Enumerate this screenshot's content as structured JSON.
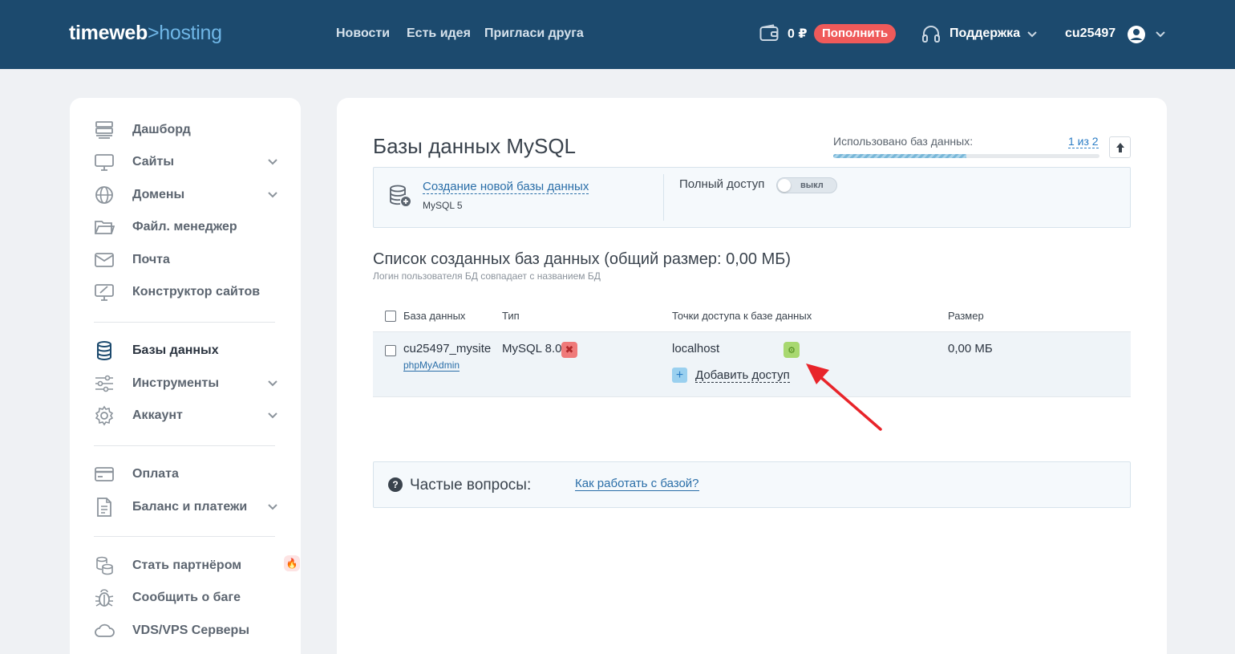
{
  "header": {
    "logo_main": "timeweb",
    "logo_sep": ">",
    "logo_sub": "hosting",
    "nav": [
      "Новости",
      "Есть идея",
      "Пригласи друга"
    ],
    "balance": "0 ₽",
    "topup_label": "Пополнить",
    "support_label": "Поддержка",
    "username": "cu25497"
  },
  "sidebar": {
    "items": [
      {
        "label": "Дашборд",
        "icon": "dashboard-icon"
      },
      {
        "label": "Сайты",
        "icon": "monitor-icon"
      },
      {
        "label": "Домены",
        "icon": "globe-icon"
      },
      {
        "label": "Файл. менеджер",
        "icon": "folder-icon"
      },
      {
        "label": "Почта",
        "icon": "mail-icon"
      },
      {
        "label": "Конструктор сайтов",
        "icon": "builder-icon"
      },
      {
        "label": "Базы данных",
        "icon": "database-icon"
      },
      {
        "label": "Инструменты",
        "icon": "sliders-icon"
      },
      {
        "label": "Аккаунт",
        "icon": "gear-icon"
      },
      {
        "label": "Оплата",
        "icon": "card-icon"
      },
      {
        "label": "Баланс и платежи",
        "icon": "document-icon"
      },
      {
        "label": "Стать партнёром",
        "icon": "coins-icon"
      },
      {
        "label": "Сообщить о баге",
        "icon": "bug-icon"
      },
      {
        "label": "VDS/VPS Серверы",
        "icon": "cloud-icon"
      }
    ]
  },
  "main": {
    "title": "Базы данных MySQL",
    "usage_label": "Использовано баз данных:",
    "usage_value": "1 из 2",
    "usage_fraction": 0.5,
    "create_link": "Создание новой базы данных",
    "create_sub": "MySQL 5",
    "full_access_label": "Полный доступ",
    "toggle_label": "выкл",
    "list_title": "Список созданных баз данных (общий размер: 0,00 МБ)",
    "list_sub": "Логин пользователя БД совпадает с названием БД",
    "columns": [
      "База данных",
      "Тип",
      "Точки доступа к базе данных",
      "Размер"
    ],
    "rows": [
      {
        "name": "cu25497_mysite",
        "admin_link": "phpMyAdmin",
        "type": "MySQL 8.0",
        "host": "localhost",
        "add_access": "Добавить доступ",
        "size": "0,00 МБ"
      }
    ],
    "faq_label": "Частые вопросы:",
    "faq_link": "Как работать с базой?"
  },
  "colors": {
    "header_bg": "#1c4a6e",
    "accent_red": "#ef5a5a",
    "link_blue": "#2a6ea8",
    "arrow_red": "#e8242a"
  }
}
